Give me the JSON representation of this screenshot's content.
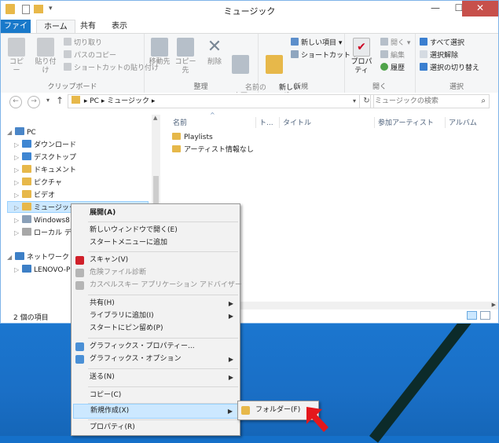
{
  "window": {
    "title": "ミュージック",
    "minimize": "—",
    "maximize": "☐",
    "close": "✕"
  },
  "tabs": [
    "ファイル",
    "ホーム",
    "共有",
    "表示"
  ],
  "ribbon": {
    "clipboard": {
      "copy": "コピー",
      "paste": "貼り付け",
      "cut": "切り取り",
      "copy_path": "パスのコピー",
      "paste_shortcut": "ショートカットの貼り付け",
      "label": "クリップボード"
    },
    "organize": {
      "move_to": "移動先",
      "copy_to": "コピー先",
      "delete": "削除",
      "rename": "名前の\n変更",
      "label": "整理"
    },
    "new": {
      "new_folder": "新しい\nフォルダー",
      "new_item": "新しい項目 ▾",
      "shortcut": "ショートカット ▾",
      "label": "新規"
    },
    "open": {
      "properties": "プロパティ",
      "open": "開く ▾",
      "edit": "編集",
      "history": "履歴",
      "label": "開く"
    },
    "select": {
      "select_all": "すべて選択",
      "select_none": "選択解除",
      "invert": "選択の切り替え",
      "label": "選択"
    }
  },
  "address": {
    "path": "▸ PC ▸ ミュージック ▸",
    "search_placeholder": "ミュージックの検索"
  },
  "tree": [
    {
      "label": "PC",
      "arrow": "◢"
    },
    {
      "label": "ダウンロード",
      "arrow": "▷"
    },
    {
      "label": "デスクトップ",
      "arrow": "▷"
    },
    {
      "label": "ドキュメント",
      "arrow": "▷"
    },
    {
      "label": "ピクチャ",
      "arrow": "▷"
    },
    {
      "label": "ビデオ",
      "arrow": "▷"
    },
    {
      "label": "ミュージック",
      "arrow": "▷"
    },
    {
      "label": "Windows8",
      "arrow": "▷"
    },
    {
      "label": "ローカル ディ",
      "arrow": "▷"
    },
    {
      "label": "ネットワーク",
      "arrow": "◢"
    },
    {
      "label": "LENOVO-P",
      "arrow": "▷"
    }
  ],
  "columns": [
    "名前",
    "ト...",
    "タイトル",
    "参加アーティスト",
    "アルバム"
  ],
  "files": [
    "Playlists",
    "アーティスト情報なし"
  ],
  "status": {
    "count": "2 個の項目"
  },
  "context_menu": [
    {
      "label": "展開(A)"
    },
    {
      "label": "新しいウィンドウで開く(E)"
    },
    {
      "label": "スタートメニューに追加"
    },
    {
      "label": "スキャン(V)"
    },
    {
      "label": "危険ファイル診断"
    },
    {
      "label": "カスペルスキー アプリケーション アドバイザー"
    },
    {
      "label": "共有(H)"
    },
    {
      "label": "ライブラリに追加(I)"
    },
    {
      "label": "スタートにピン留め(P)"
    },
    {
      "label": "グラフィックス・プロパティー..."
    },
    {
      "label": "グラフィックス・オプション"
    },
    {
      "label": "送る(N)"
    },
    {
      "label": "コピー(C)"
    },
    {
      "label": "新規作成(X)"
    },
    {
      "label": "プロパティ(R)"
    }
  ],
  "submenu": {
    "folder": "フォルダー(F)"
  },
  "colors": {
    "accent": "#1979ca",
    "selection": "#cce8ff",
    "desktop": "#1570c9",
    "arrow": "#e4171c"
  }
}
